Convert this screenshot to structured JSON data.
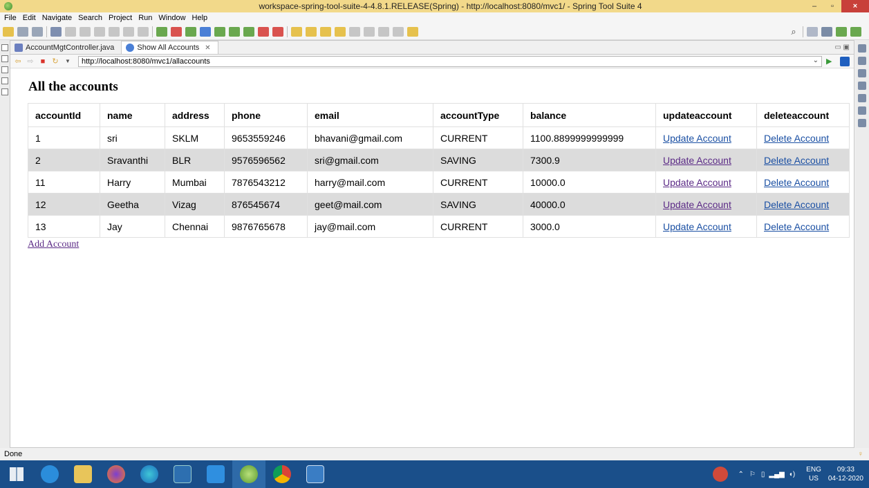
{
  "window": {
    "title": "workspace-spring-tool-suite-4-4.8.1.RELEASE(Spring) - http://localhost:8080/mvc1/ - Spring Tool Suite 4",
    "minimize": "–",
    "maximize": "▫",
    "close": "×"
  },
  "menu": [
    "File",
    "Edit",
    "Navigate",
    "Search",
    "Project",
    "Run",
    "Window",
    "Help"
  ],
  "tabs": [
    {
      "label": "AccountMgtController.java",
      "icon_color": "#6b7fbf"
    },
    {
      "label": "Show All Accounts",
      "icon_color": "#4a7fd6",
      "close": "✕"
    }
  ],
  "browser": {
    "url": "http://localhost:8080/mvc1/allaccounts"
  },
  "page": {
    "heading": "All the accounts",
    "columns": [
      "accountId",
      "name",
      "address",
      "phone",
      "email",
      "accountType",
      "balance",
      "updateaccount",
      "deleteaccount"
    ],
    "rows": [
      {
        "accountId": "1",
        "name": "sri",
        "address": "SKLM",
        "phone": "9653559246",
        "email": "bhavani@gmail.com",
        "accountType": "CURRENT",
        "balance": "1100.8899999999999",
        "update": "Update Account",
        "delete": "Delete Account"
      },
      {
        "accountId": "2",
        "name": "Sravanthi",
        "address": "BLR",
        "phone": "9576596562",
        "email": "sri@gmail.com",
        "accountType": "SAVING",
        "balance": "7300.9",
        "update": "Update Account",
        "delete": "Delete Account"
      },
      {
        "accountId": "11",
        "name": "Harry",
        "address": "Mumbai",
        "phone": "7876543212",
        "email": "harry@mail.com",
        "accountType": "CURRENT",
        "balance": "10000.0",
        "update": "Update Account",
        "delete": "Delete Account"
      },
      {
        "accountId": "12",
        "name": "Geetha",
        "address": "Vizag",
        "phone": "876545674",
        "email": "geet@mail.com",
        "accountType": "SAVING",
        "balance": "40000.0",
        "update": "Update Account",
        "delete": "Delete Account"
      },
      {
        "accountId": "13",
        "name": "Jay",
        "address": "Chennai",
        "phone": "9876765678",
        "email": "jay@mail.com",
        "accountType": "CURRENT",
        "balance": "3000.0",
        "update": "Update Account",
        "delete": "Delete Account"
      }
    ],
    "add_link": "Add Account"
  },
  "status": "Done",
  "taskbar": {
    "apps": [
      "windows-start",
      "internet-explorer",
      "file-explorer",
      "firefox",
      "edge",
      "snipping-tool",
      "vscode",
      "spring-tool-suite",
      "chrome",
      "photos"
    ],
    "lang_top": "ENG",
    "lang_bottom": "US",
    "time": "09:33",
    "date": "04-12-2020"
  },
  "colors": {
    "titlebar": "#f2d98a",
    "link": "#1a4fa3",
    "visited_link": "#5b2a86",
    "row_alt": "#dcdcdc",
    "taskbar": "#1a4f8a"
  }
}
